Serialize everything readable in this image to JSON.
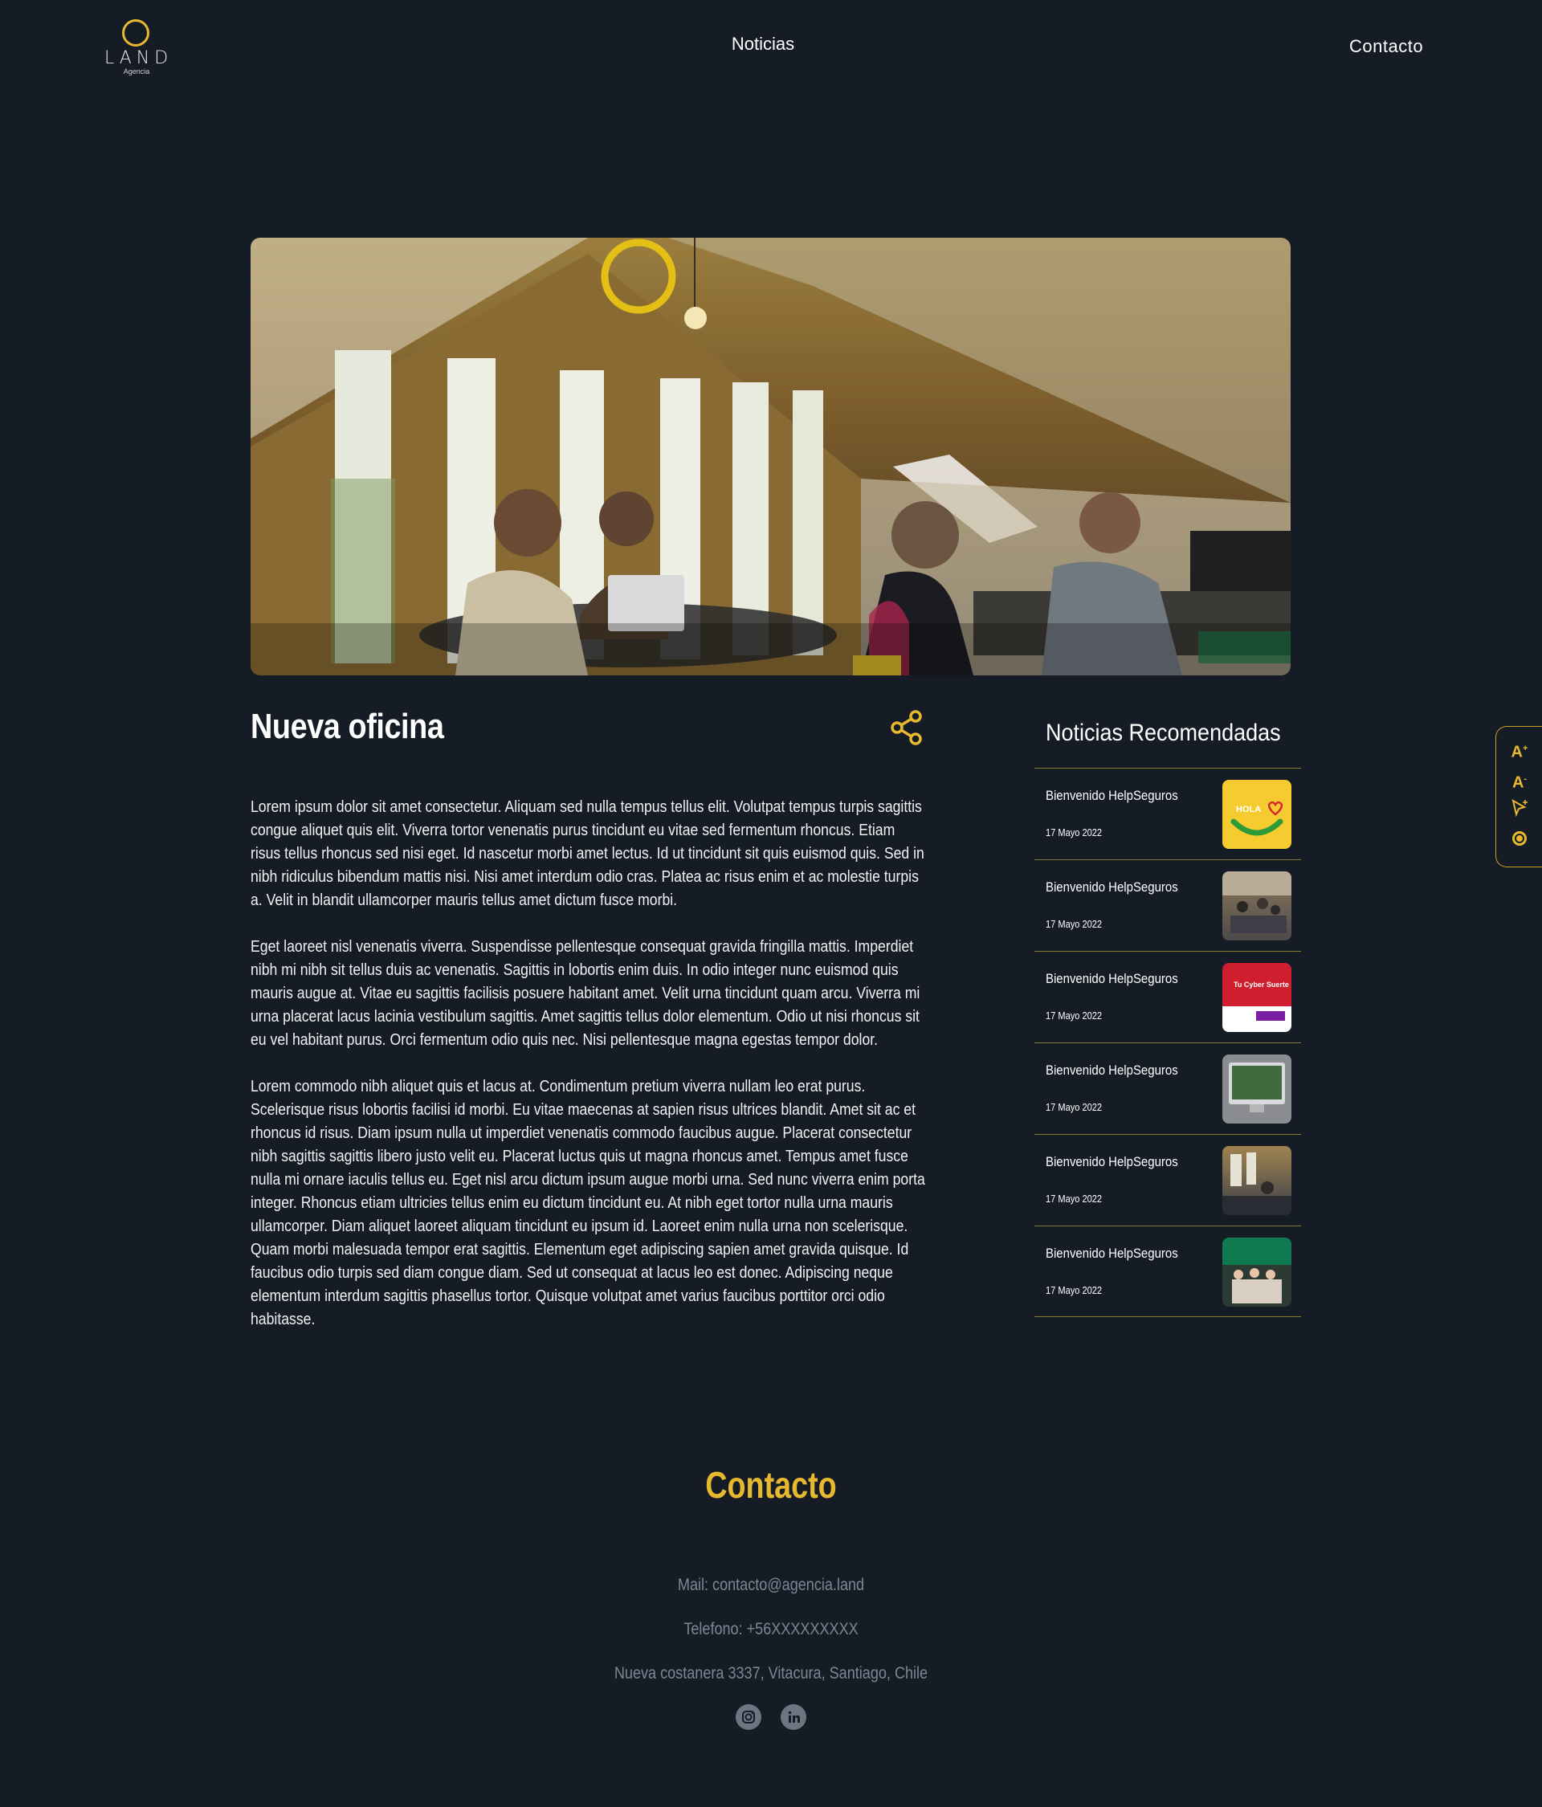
{
  "header": {
    "logo_word": "LAND",
    "logo_sub": "Agencia",
    "nav_noticias": "Noticias",
    "nav_contacto": "Contacto"
  },
  "article": {
    "title": "Nueva oficina",
    "paragraphs": [
      "Lorem ipsum dolor sit amet consectetur. Aliquam sed nulla tempus tellus elit. Volutpat tempus turpis sagittis congue aliquet quis elit. Viverra tortor venenatis purus tincidunt eu vitae sed fermentum rhoncus. Etiam risus tellus rhoncus sed nisi eget. Id nascetur morbi amet lectus. Id ut tincidunt sit quis euismod quis. Sed in nibh ridiculus bibendum mattis nisi. Nisi amet interdum odio cras. Platea ac risus enim et ac molestie turpis a. Velit in blandit ullamcorper mauris tellus amet dictum fusce morbi.",
      "Eget laoreet nisl venenatis viverra. Suspendisse pellentesque consequat gravida fringilla mattis. Imperdiet nibh mi nibh sit tellus duis ac venenatis. Sagittis in lobortis enim duis. In odio integer nunc euismod quis mauris augue at. Vitae eu sagittis facilisis posuere habitant amet. Velit urna tincidunt quam arcu. Viverra mi urna placerat lacus lacinia vestibulum sagittis. Amet sagittis tellus dolor elementum. Odio ut nisi rhoncus sit eu vel habitant purus. Orci fermentum odio quis nec. Nisi pellentesque magna egestas tempor dolor.",
      "Lorem commodo nibh aliquet quis et lacus at. Condimentum pretium viverra nullam leo erat purus. Scelerisque risus lobortis facilisi id morbi. Eu vitae maecenas at sapien risus ultrices blandit. Amet sit ac et rhoncus id risus. Diam ipsum nulla ut imperdiet venenatis commodo faucibus augue. Placerat consectetur nibh sagittis sagittis libero justo velit eu. Placerat luctus quis ut magna rhoncus amet. Tempus amet fusce nulla mi ornare iaculis tellus eu. Eget nisl arcu dictum ipsum augue morbi urna. Sed nunc viverra enim porta integer. Rhoncus etiam ultricies tellus enim eu dictum tincidunt eu. At nibh eget tortor nulla urna mauris ullamcorper. Diam aliquet laoreet aliquam tincidunt eu ipsum id. Laoreet enim nulla urna non scelerisque. Quam morbi malesuada tempor erat sagittis. Elementum eget adipiscing sapien amet gravida quisque. Id faucibus odio turpis sed diam congue diam. Sed ut consequat at lacus leo est donec. Adipiscing neque elementum interdum sagittis phasellus tortor. Quisque volutpat amet varius faucibus porttitor orci odio habitasse."
    ]
  },
  "sidebar": {
    "title": "Noticias Recomendadas",
    "items": [
      {
        "title": "Bienvenido HelpSeguros",
        "date": "17 Mayo 2022",
        "thumb_label": "HOLA"
      },
      {
        "title": "Bienvenido HelpSeguros",
        "date": "17 Mayo 2022"
      },
      {
        "title": "Bienvenido HelpSeguros",
        "date": "17 Mayo 2022",
        "thumb_label": "Tu Cyber Suerte"
      },
      {
        "title": "Bienvenido HelpSeguros",
        "date": "17 Mayo 2022"
      },
      {
        "title": "Bienvenido HelpSeguros",
        "date": "17 Mayo 2022"
      },
      {
        "title": "Bienvenido HelpSeguros",
        "date": "17 Mayo 2022"
      }
    ]
  },
  "accessibility": {
    "increase_font": "A",
    "decrease_font": "A"
  },
  "contact": {
    "title": "Contacto",
    "mail": "Mail: contacto@agencia.land",
    "phone": "Telefono: +56XXXXXXXXX",
    "address": "Nueva costanera 3337, Vitacura, Santiago, Chile"
  },
  "colors": {
    "background": "#161c26",
    "accent": "#e7b92f",
    "muted": "#7f8693"
  },
  "icons": [
    "share-icon",
    "instagram-icon",
    "linkedin-icon",
    "font-increase-icon",
    "font-decrease-icon",
    "cursor-icon",
    "contrast-icon"
  ]
}
